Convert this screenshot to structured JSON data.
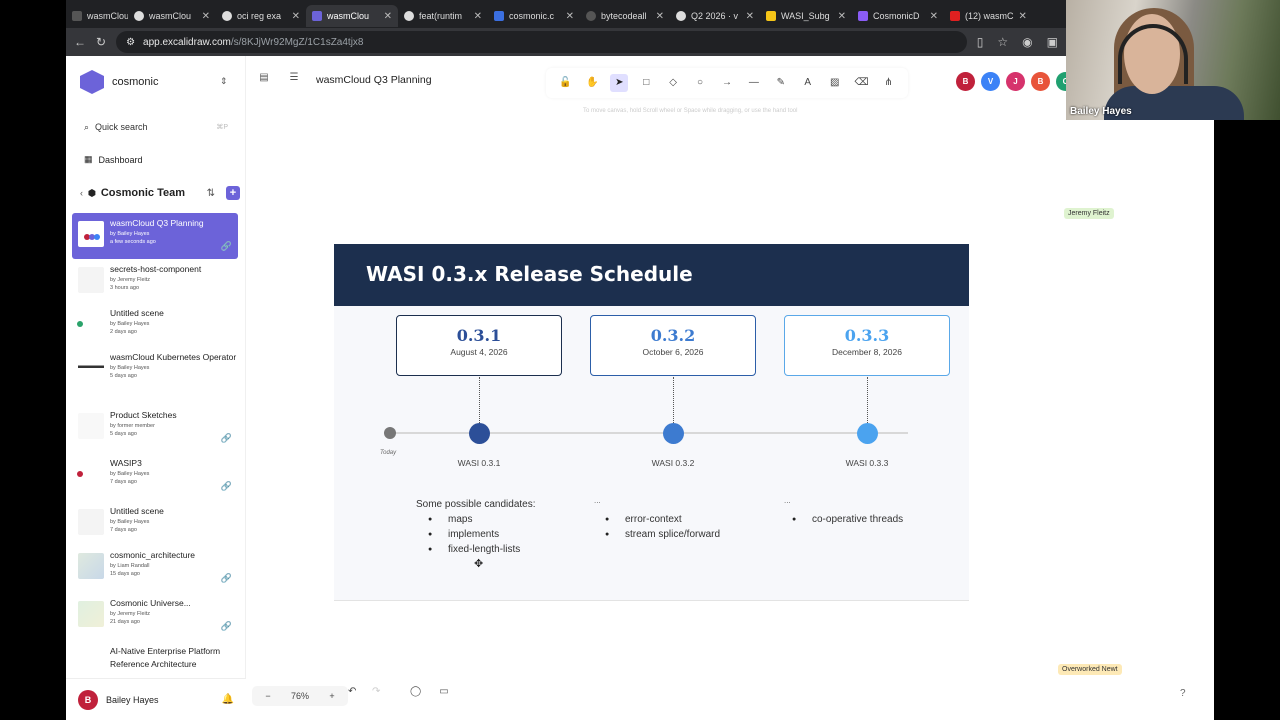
{
  "browser": {
    "tabs": [
      {
        "label": "wasmCloud",
        "active": false,
        "color": "#888"
      },
      {
        "label": "wasmClou",
        "active": false,
        "color": "#fff"
      },
      {
        "label": "oci reg exa",
        "active": false,
        "color": "#fff"
      },
      {
        "label": "wasmClou",
        "active": true,
        "color": "#6c63d9"
      },
      {
        "label": "feat(runtim",
        "active": false,
        "color": "#fff"
      },
      {
        "label": "cosmonic.c",
        "active": false,
        "color": "#3b6fe0"
      },
      {
        "label": "bytecodeall",
        "active": false,
        "color": "#444"
      },
      {
        "label": "Q2 2026 · v",
        "active": false,
        "color": "#fff"
      },
      {
        "label": "WASI_Subg",
        "active": false,
        "color": "#f5c518"
      },
      {
        "label": "CosmonicD",
        "active": false,
        "color": "#8a5cf5"
      },
      {
        "label": "(12) wasmC",
        "active": false,
        "color": "#e02020"
      }
    ],
    "url_host": "app.excalidraw.com",
    "url_path": "/s/8KJjWr92MgZ/1C1sZa4tjx8"
  },
  "sidebar": {
    "org_name": "cosmonic",
    "search_placeholder": "Quick search",
    "search_shortcut": "⌘P",
    "dashboard_label": "Dashboard",
    "team_name": "Cosmonic Team",
    "scenes": [
      {
        "title": "wasmCloud Q3 Planning",
        "author": "by Bailey Hayes",
        "time": "a few seconds ago",
        "active": true,
        "linked": true
      },
      {
        "title": "secrets-host-component",
        "author": "by Jeremy Fleitz",
        "time": "3 hours ago",
        "active": false,
        "linked": false
      },
      {
        "title": "Untitled scene",
        "author": "by Bailey Hayes",
        "time": "2 days ago",
        "active": false,
        "linked": false,
        "dot": "#2aa36b"
      },
      {
        "title": "wasmCloud Kubernetes Operator",
        "author": "by Bailey Hayes",
        "time": "5 days ago",
        "active": false,
        "linked": false
      },
      {
        "title": "Product Sketches",
        "author": "by former member",
        "time": "5 days ago",
        "active": false,
        "linked": true
      },
      {
        "title": "WASIP3",
        "author": "by Bailey Hayes",
        "time": "7 days ago",
        "active": false,
        "linked": true,
        "dot": "#c0213b"
      },
      {
        "title": "Untitled scene",
        "author": "by Bailey Hayes",
        "time": "7 days ago",
        "active": false,
        "linked": false
      },
      {
        "title": "cosmonic_architecture",
        "author": "by Liam Randall",
        "time": "15 days ago",
        "active": false,
        "linked": true
      },
      {
        "title": "Cosmonic Universe...",
        "author": "by Jeremy Fleitz",
        "time": "21 days ago",
        "active": false,
        "linked": true
      },
      {
        "title": "AI-Native Enterprise Platform Reference Architecture",
        "author": "",
        "time": "",
        "active": false,
        "linked": false
      }
    ],
    "user_initial": "B",
    "user_name": "Bailey Hayes"
  },
  "canvas": {
    "scene_title": "wasmCloud Q3 Planning",
    "hint": "To move canvas, hold Scroll wheel or Space while dragging, or use the hand tool",
    "collaborators": [
      {
        "initial": "B",
        "color": "#c0213b"
      },
      {
        "initial": "V",
        "color": "#3b82f6"
      },
      {
        "initial": "J",
        "color": "#d6336c"
      },
      {
        "initial": "B",
        "color": "#e8543a"
      },
      {
        "initial": "C",
        "color": "#20a070"
      }
    ],
    "cursor_labels": [
      "Jeremy Fleitz",
      "Overworked Newt"
    ],
    "zoom_level": "76%"
  },
  "slide": {
    "title": "WASI 0.3.x Release Schedule",
    "releases": [
      {
        "version": "0.3.1",
        "date": "August 4, 2026",
        "label": "WASI 0.3.1",
        "color": "#2c4f98",
        "border": "#1c2f4e"
      },
      {
        "version": "0.3.2",
        "date": "October 6, 2026",
        "label": "WASI 0.3.2",
        "color": "#3d7bd0",
        "border": "#2c5ea8"
      },
      {
        "version": "0.3.3",
        "date": "December 8, 2026",
        "label": "WASI 0.3.3",
        "color": "#4ba3ef",
        "border": "#5aa8e8"
      }
    ],
    "today_label": "Today",
    "candidates_title": "Some possible candidates:",
    "candidates_1": [
      "maps",
      "implements",
      "fixed-length-lists"
    ],
    "candidates_2": [
      "error-context",
      "stream splice/forward"
    ],
    "candidates_3": [
      "co-operative threads"
    ],
    "ellipsis": "..."
  },
  "webcam": {
    "name": "Bailey Hayes"
  }
}
